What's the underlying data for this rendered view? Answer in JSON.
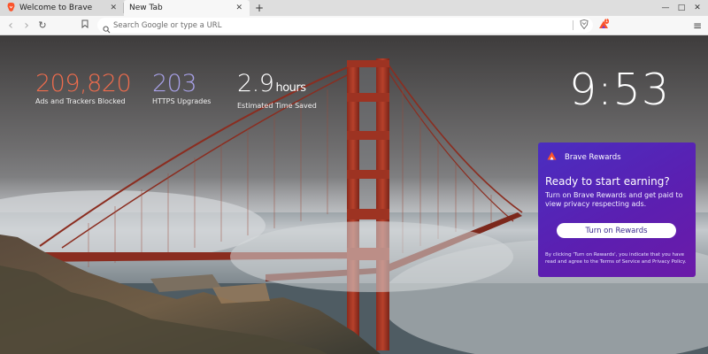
{
  "tabs": [
    {
      "title": "Welcome to Brave",
      "icon": "brave-lion-icon",
      "close": "✕"
    },
    {
      "title": "New Tab",
      "close": "✕"
    }
  ],
  "tabstrip": {
    "new_tab": "+",
    "win_minimize": "—",
    "win_maximize": "□",
    "win_close": "✕"
  },
  "toolbar": {
    "back": "‹",
    "forward": "›",
    "reload": "↻",
    "menu": "≡"
  },
  "omnibox": {
    "placeholder": "Search Google or type a URL",
    "value": ""
  },
  "extensions": {
    "rewards_badge": "1"
  },
  "stats": {
    "ads": {
      "value": "209,820",
      "label": "Ads and Trackers Blocked",
      "color": "#ee6c4d"
    },
    "https": {
      "value": "203",
      "label": "HTTPS Upgrades",
      "color": "#a8a1e8"
    },
    "time": {
      "value": "2.9",
      "unit": "hours",
      "label": "Estimated Time Saved"
    }
  },
  "clock": "9:53",
  "rewards": {
    "header": "Brave Rewards",
    "headline": "Ready to start earning?",
    "description": "Turn on Brave Rewards and get paid to view privacy respecting ads.",
    "button": "Turn on Rewards",
    "legal": "By clicking 'Turn on Rewards', you indicate that you have read and agree to the Terms of Service and Privacy Policy."
  },
  "colors": {
    "accent": "#fb542b",
    "rewards_gradient": [
      "#4a2ec0",
      "#6b1aa8"
    ]
  }
}
